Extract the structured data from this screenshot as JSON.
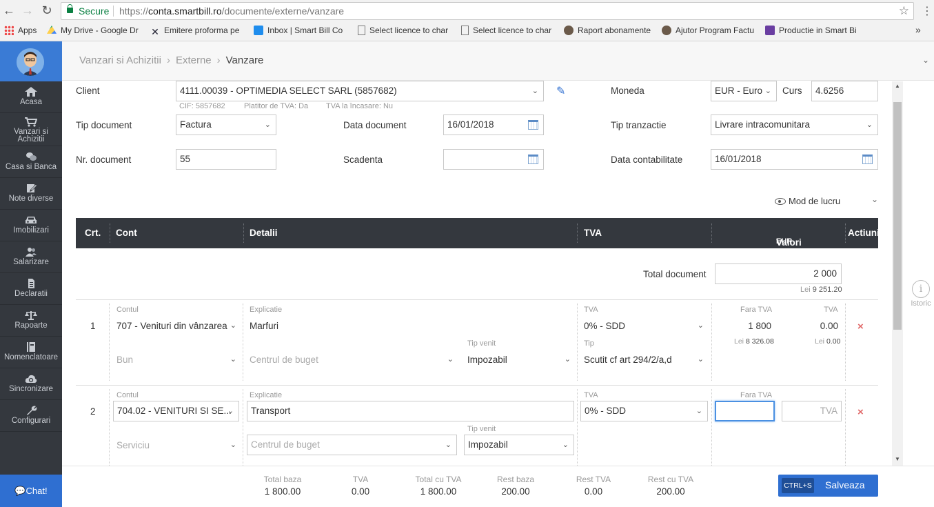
{
  "browser": {
    "secure_label": "Secure",
    "url_scheme": "https://",
    "url_host": "conta.smartbill.ro",
    "url_path": "/documente/externe/vanzare",
    "bookmarks": [
      {
        "label": "Apps",
        "icon": "apps-grid-icon"
      },
      {
        "label": "My Drive - Google Dr",
        "icon": "google-drive-icon"
      },
      {
        "label": "Emitere proforma pe",
        "icon": "x-logo-icon"
      },
      {
        "label": "Inbox | Smart Bill Co",
        "icon": "intercom-icon"
      },
      {
        "label": "Select licence to char",
        "icon": "page-icon"
      },
      {
        "label": "Select licence to char",
        "icon": "page-icon"
      },
      {
        "label": "Raport abonamente",
        "icon": "user-avatar-icon"
      },
      {
        "label": "Ajutor Program Factu",
        "icon": "user-avatar-icon"
      },
      {
        "label": "Productie in Smart Bi",
        "icon": "list-icon"
      }
    ],
    "more": "»"
  },
  "sidebar": {
    "items": [
      {
        "label": "Acasa",
        "icon": "home-icon"
      },
      {
        "label": "Vanzari si Achizitii",
        "icon": "cart-icon"
      },
      {
        "label": "Casa si Banca",
        "icon": "coins-icon"
      },
      {
        "label": "Note diverse",
        "icon": "edit-icon"
      },
      {
        "label": "Imobilizari",
        "icon": "car-icon"
      },
      {
        "label": "Salarizare",
        "icon": "users-icon"
      },
      {
        "label": "Declaratii",
        "icon": "document-icon"
      },
      {
        "label": "Rapoarte",
        "icon": "balance-scale-icon"
      },
      {
        "label": "Nomenclatoare",
        "icon": "book-icon"
      },
      {
        "label": "Sincronizare",
        "icon": "cloud-sync-icon"
      },
      {
        "label": "Configurari",
        "icon": "wrench-icon"
      }
    ],
    "chat_label": "Chat!"
  },
  "breadcrumb": {
    "items": [
      "Vanzari si Achizitii",
      "Externe",
      "Vanzare"
    ]
  },
  "form": {
    "client_label": "Client",
    "client_value": "4111.00039 - OPTIMEDIA SELECT SARL (5857682)",
    "client_cif": "CIF: 5857682",
    "client_platitor": "Platitor de TVA: Da",
    "client_tva_incasare": "TVA la încasare: Nu",
    "moneda_label": "Moneda",
    "moneda_value": "EUR - Euro",
    "curs_label": "Curs",
    "curs_value": "4.6256",
    "tip_document_label": "Tip document",
    "tip_document_value": "Factura",
    "data_document_label": "Data document",
    "data_document_value": "16/01/2018",
    "tip_tranzactie_label": "Tip tranzactie",
    "tip_tranzactie_value": "Livrare intracomunitara",
    "nr_document_label": "Nr. document",
    "nr_document_value": "55",
    "scadenta_label": "Scadenta",
    "scadenta_value": "",
    "data_contabilitate_label": "Data contabilitate",
    "data_contabilitate_value": "16/01/2018",
    "mod_de_lucru": "Mod de lucru"
  },
  "table": {
    "headers": {
      "crt": "Crt.",
      "cont": "Cont",
      "detalii": "Detalii",
      "tva": "TVA",
      "valori": "Valori",
      "valori_currency": "EUR - Euro",
      "actiuni": "Actiuni"
    },
    "total_document_label": "Total document",
    "total_document_value": "2 000",
    "total_lei_prefix": "Lei",
    "total_lei_value": "9 251.20",
    "rows": [
      {
        "crt": "1",
        "contul_label": "Contul",
        "contul_value": "707 - Venituri din vânzarea",
        "explicatie_label": "Explicatie",
        "explicatie_value": "Marfuri",
        "tva_label": "TVA",
        "tva_value": "0% - SDD",
        "fara_tva_label": "Fara TVA",
        "fara_tva_value": "1 800",
        "tva_col_label": "TVA",
        "tva_col_value": "0.00",
        "lei_prefix": "Lei",
        "lei_fara_tva": "8 326.08",
        "lei_tva": "0.00",
        "tip_bun_placeholder": "Bun",
        "centru_placeholder": "Centrul de buget",
        "tip_venit_label": "Tip venit",
        "tip_venit_value": "Impozabil",
        "tip_label": "Tip",
        "tip_value": "Scutit cf art 294/2/a,d"
      },
      {
        "crt": "2",
        "contul_label": "Contul",
        "contul_value": "704.02 - VENITURI SI SE...",
        "explicatie_label": "Explicatie",
        "explicatie_value": "Transport",
        "tva_label": "TVA",
        "tva_value": "0% - SDD",
        "fara_tva_label": "Fara TVA",
        "fara_tva_value": "",
        "tva_placeholder": "TVA",
        "tip_bun_placeholder": "Serviciu",
        "centru_placeholder": "Centrul de buget",
        "tip_venit_label": "Tip venit",
        "tip_venit_value": "Impozabil"
      }
    ]
  },
  "footer": {
    "totals": [
      {
        "label": "Total baza",
        "value": "1 800.00"
      },
      {
        "label": "TVA",
        "value": "0.00"
      },
      {
        "label": "Total cu TVA",
        "value": "1 800.00"
      },
      {
        "label": "Rest baza",
        "value": "200.00"
      },
      {
        "label": "Rest TVA",
        "value": "0.00"
      },
      {
        "label": "Rest cu TVA",
        "value": "200.00"
      }
    ],
    "shortcut": "CTRL+S",
    "save_label": "Salveaza"
  },
  "istoric_label": "Istoric",
  "colors": {
    "accent": "#2f6fd1",
    "sidebar": "#34383e",
    "delete": "#e06666",
    "secure": "#0b8043"
  }
}
